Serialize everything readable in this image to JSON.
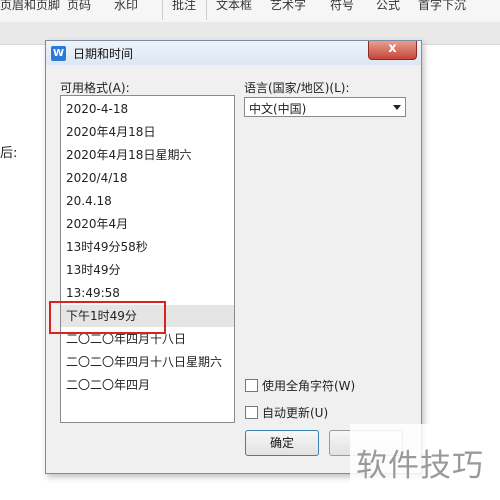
{
  "ribbon": {
    "items": [
      "页眉和页脚",
      "页码",
      "水印",
      "批注",
      "文本框",
      "艺术字",
      "符号",
      "公式",
      "首字下沉"
    ]
  },
  "document": {
    "partial_text": "后:"
  },
  "dialog": {
    "title": "日期和时间",
    "close_symbol": "x",
    "formats_label": "可用格式(A):",
    "formats": [
      "2020-4-18",
      "2020年4月18日",
      "2020年4月18日星期六",
      "2020/4/18",
      "20.4.18",
      "2020年4月",
      "13时49分58秒",
      "13时49分",
      "13:49:58",
      "下午1时49分",
      "二〇二〇年四月十八日",
      "二〇二〇年四月十八日星期六",
      "二〇二〇年四月"
    ],
    "selected_index": 9,
    "language_label": "语言(国家/地区)(L):",
    "language_value": "中文(中国)",
    "fullwidth_label": "使用全角字符(W)",
    "fullwidth_checked": false,
    "autoupdate_label": "自动更新(U)",
    "autoupdate_checked": false,
    "ok_label": "确定"
  },
  "watermark": {
    "text": "软件技巧"
  },
  "colors": {
    "highlight_border": "#d9231c",
    "ok_border": "#3c7fb1",
    "close_red": "#c6453a"
  }
}
